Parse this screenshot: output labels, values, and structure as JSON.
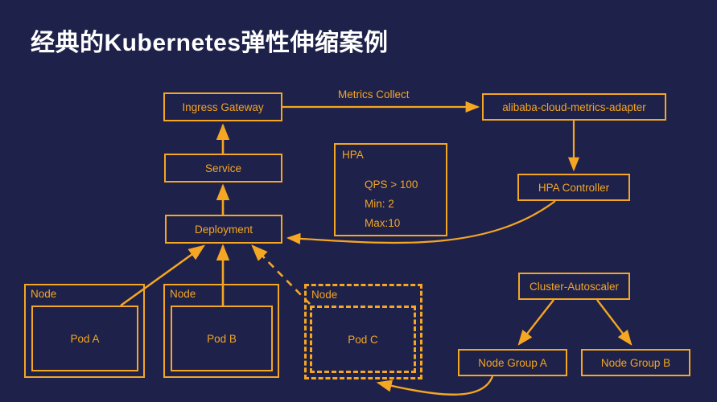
{
  "slide": {
    "title": "经典的Kubernetes弹性伸缩案例",
    "background_color": "#1e2149",
    "accent_color": "#f5a623",
    "title_color": "#ffffff"
  },
  "diagram": {
    "type": "architecture-flow",
    "nodes": {
      "ingress_gateway": "Ingress Gateway",
      "service": "Service",
      "deployment": "Deployment",
      "metrics_adapter": "alibaba-cloud-metrics-adapter",
      "hpa_controller": "HPA Controller",
      "cluster_autoscaler": "Cluster-Autoscaler",
      "node_group_a": "Node Group A",
      "node_group_b": "Node Group B",
      "node_a_label": "Node",
      "node_b_label": "Node",
      "node_c_label": "Node",
      "pod_a": "Pod A",
      "pod_b": "Pod B",
      "pod_c": "Pod C"
    },
    "hpa_panel": {
      "title": "HPA",
      "line1": "QPS > 100",
      "line2": "Min: 2",
      "line3": "Max:10"
    },
    "edges": [
      {
        "label": "Metrics Collect",
        "from": "ingress_gateway",
        "to": "metrics_adapter",
        "style": "solid"
      },
      {
        "label": "",
        "from": "service",
        "to": "ingress_gateway",
        "style": "solid"
      },
      {
        "label": "",
        "from": "deployment",
        "to": "service",
        "style": "solid"
      },
      {
        "label": "",
        "from": "metrics_adapter",
        "to": "hpa_controller",
        "style": "solid"
      },
      {
        "label": "",
        "from": "hpa_controller",
        "to": "deployment",
        "style": "solid-curve"
      },
      {
        "label": "",
        "from": "pod_a",
        "to": "deployment",
        "style": "solid"
      },
      {
        "label": "",
        "from": "pod_b",
        "to": "deployment",
        "style": "solid"
      },
      {
        "label": "",
        "from": "pod_c",
        "to": "deployment",
        "style": "dashed"
      },
      {
        "label": "",
        "from": "cluster_autoscaler",
        "to": "node_group_a",
        "style": "solid"
      },
      {
        "label": "",
        "from": "cluster_autoscaler",
        "to": "node_group_b",
        "style": "solid"
      },
      {
        "label": "",
        "from": "node_group_a",
        "to": "pod_c",
        "style": "solid-curve"
      }
    ]
  }
}
